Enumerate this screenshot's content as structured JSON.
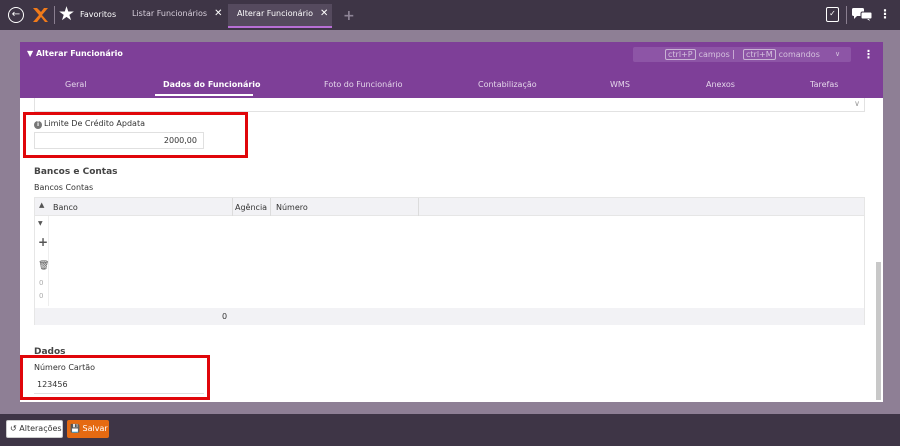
{
  "topbar": {
    "favorites_label": "Favoritos",
    "tabs": [
      {
        "label": "Listar Funcionários",
        "close": "✕"
      },
      {
        "label": "Alterar Funcionário",
        "close": "✕"
      }
    ],
    "add_tab": "+",
    "icons": [
      "back-icon",
      "logo-icon",
      "star-icon",
      "clipboard-icon",
      "chat-icon",
      "kebab-icon"
    ]
  },
  "panel": {
    "title": "Alterar Funcionário",
    "shortcuts": {
      "campos_key": "ctrl+P",
      "campos_label": "campos",
      "separator": "|",
      "comandos_key": "ctrl+M",
      "comandos_label": "comandos"
    },
    "tabs": [
      "Geral",
      "Dados do Funcionário",
      "Foto do Funcionário",
      "Contabilização",
      "WMS",
      "Anexos",
      "Tarefas"
    ],
    "active_tab": "Dados do Funcionário"
  },
  "form": {
    "credit_limit_label": "Limite De Crédito Apdata",
    "credit_limit_value": "2000,00",
    "banks_section_title": "Bancos e Contas",
    "banks_grid_label": "Bancos Contas",
    "grid": {
      "columns": [
        "Banco",
        "Agência",
        "Número"
      ],
      "side_numbers": [
        "0",
        "0"
      ],
      "footer_total": "0"
    },
    "data_section_title": "Dados",
    "card_number_label": "Número Cartão",
    "card_number_value": "123456"
  },
  "bottombar": {
    "changes_button": "Alterações",
    "save_button": "Salvar"
  },
  "colors": {
    "header_purple": "#7e3f98",
    "topbar_dark": "#3e3546",
    "highlight_red": "#e0060a",
    "save_orange": "#e56a12"
  }
}
